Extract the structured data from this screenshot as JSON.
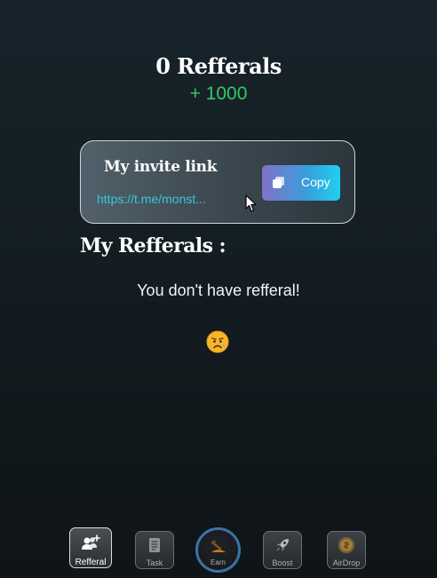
{
  "header": {
    "referral_count_label": "0 Refferals",
    "bonus": "+ 1000"
  },
  "invite": {
    "title": "My invite link",
    "link": "https://t.me/monst...",
    "copy_label": "Copy"
  },
  "referrals": {
    "section_title": "My Refferals :",
    "empty_message": "You don't have refferal!",
    "empty_emoji": "sad-face-icon"
  },
  "bottom_nav": {
    "items": [
      {
        "label": "Refferal",
        "icon": "add-users-icon",
        "active": true
      },
      {
        "label": "Task",
        "icon": "task-list-icon",
        "active": false
      },
      {
        "label": "Earn",
        "icon": "earn-icon",
        "active": false
      },
      {
        "label": "Boost",
        "icon": "rocket-icon",
        "active": false
      },
      {
        "label": "AirDrop",
        "icon": "coin-icon",
        "active": false
      }
    ]
  },
  "colors": {
    "bonus_green": "#35c76a",
    "link_cyan": "#35c7e0",
    "copy_gradient_start": "#8271c7",
    "copy_gradient_end": "#1ed0ef"
  }
}
